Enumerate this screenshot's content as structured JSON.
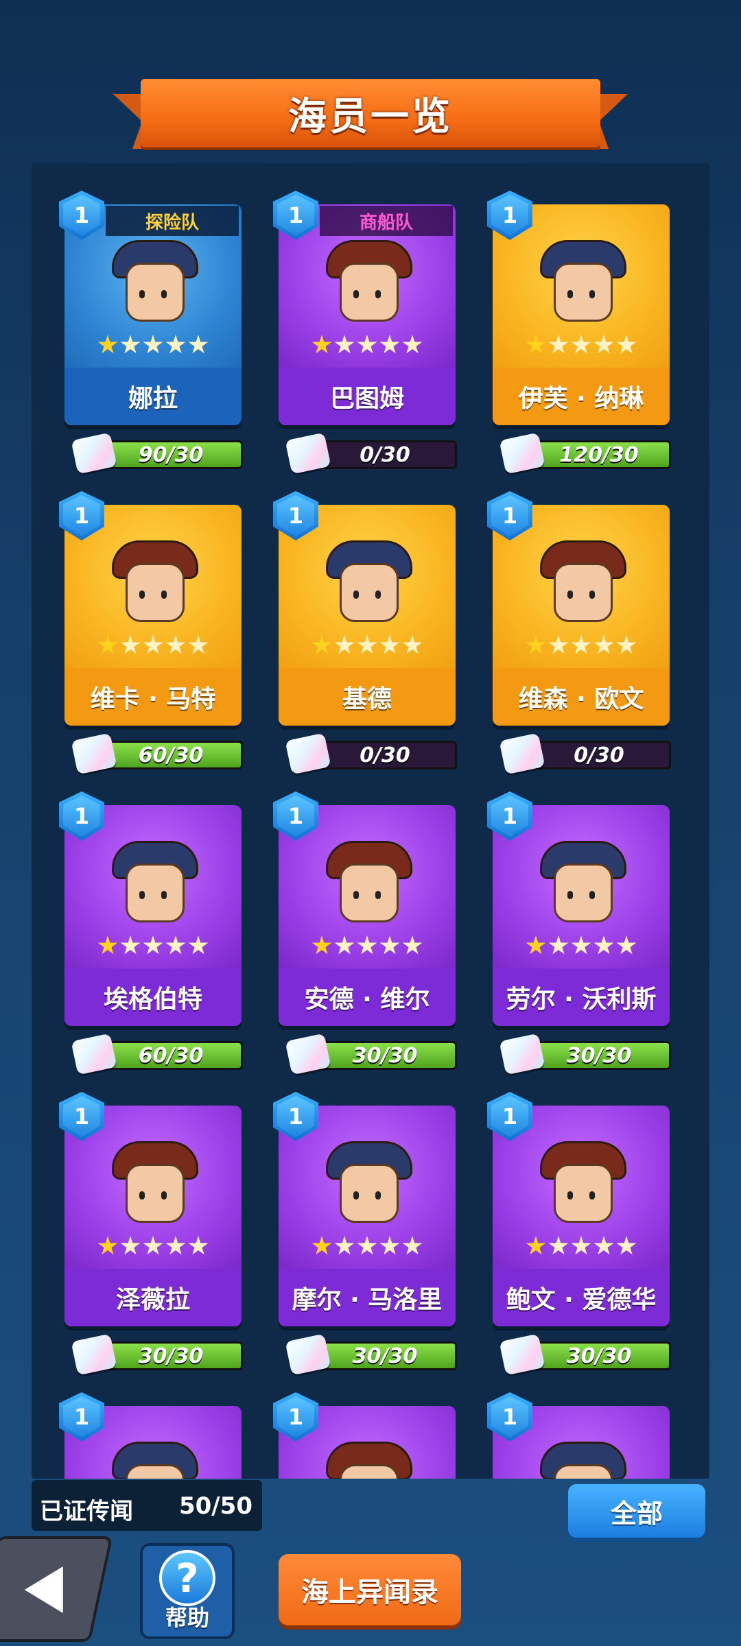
{
  "header": {
    "title": "海员一览"
  },
  "crew": [
    {
      "level": "1",
      "name": "娜拉",
      "team": "探险队",
      "rarity": "blue",
      "stars_filled": 1,
      "stars_total": 5,
      "shards": "90/30",
      "progress": 1.0,
      "accent": "#2f86d4"
    },
    {
      "level": "1",
      "name": "巴图姆",
      "team": "商船队",
      "rarity": "purple",
      "stars_filled": 1,
      "stars_total": 5,
      "shards": "0/30",
      "progress": 0.0,
      "accent": "#9b3fe8"
    },
    {
      "level": "1",
      "name": "伊芙 · 纳琳",
      "team": "",
      "rarity": "gold",
      "stars_filled": 1,
      "stars_total": 5,
      "shards": "120/30",
      "progress": 1.0,
      "accent": "#f9b520"
    },
    {
      "level": "1",
      "name": "维卡 · 马特",
      "team": "",
      "rarity": "gold",
      "stars_filled": 1,
      "stars_total": 5,
      "shards": "60/30",
      "progress": 1.0,
      "accent": "#f9b520"
    },
    {
      "level": "1",
      "name": "基德",
      "team": "",
      "rarity": "gold",
      "stars_filled": 1,
      "stars_total": 5,
      "shards": "0/30",
      "progress": 0.0,
      "accent": "#f9b520"
    },
    {
      "level": "1",
      "name": "维森 · 欧文",
      "team": "",
      "rarity": "gold",
      "stars_filled": 1,
      "stars_total": 5,
      "shards": "0/30",
      "progress": 0.0,
      "accent": "#f9b520"
    },
    {
      "level": "1",
      "name": "埃格伯特",
      "team": "",
      "rarity": "purple",
      "stars_filled": 1,
      "stars_total": 5,
      "shards": "60/30",
      "progress": 1.0,
      "accent": "#9b3fe8"
    },
    {
      "level": "1",
      "name": "安德 · 维尔",
      "team": "",
      "rarity": "purple",
      "stars_filled": 1,
      "stars_total": 5,
      "shards": "30/30",
      "progress": 1.0,
      "accent": "#9b3fe8"
    },
    {
      "level": "1",
      "name": "劳尔 · 沃利斯",
      "team": "",
      "rarity": "purple",
      "stars_filled": 1,
      "stars_total": 5,
      "shards": "30/30",
      "progress": 1.0,
      "accent": "#9b3fe8"
    },
    {
      "level": "1",
      "name": "泽薇拉",
      "team": "",
      "rarity": "purple",
      "stars_filled": 1,
      "stars_total": 5,
      "shards": "30/30",
      "progress": 1.0,
      "accent": "#9b3fe8"
    },
    {
      "level": "1",
      "name": "摩尔 · 马洛里",
      "team": "",
      "rarity": "purple",
      "stars_filled": 1,
      "stars_total": 5,
      "shards": "30/30",
      "progress": 1.0,
      "accent": "#9b3fe8"
    },
    {
      "level": "1",
      "name": "鲍文 · 爱德华",
      "team": "",
      "rarity": "purple",
      "stars_filled": 1,
      "stars_total": 5,
      "shards": "30/30",
      "progress": 1.0,
      "accent": "#9b3fe8"
    },
    {
      "level": "1",
      "name": "",
      "team": "",
      "rarity": "purple",
      "stars_filled": 0,
      "stars_total": 0,
      "shards": "",
      "progress": 0.0,
      "accent": "#9b3fe8"
    },
    {
      "level": "1",
      "name": "",
      "team": "",
      "rarity": "purple",
      "stars_filled": 0,
      "stars_total": 0,
      "shards": "",
      "progress": 0.0,
      "accent": "#9b3fe8"
    },
    {
      "level": "1",
      "name": "",
      "team": "",
      "rarity": "purple",
      "stars_filled": 0,
      "stars_total": 0,
      "shards": "",
      "progress": 0.0,
      "accent": "#9b3fe8"
    }
  ],
  "footer": {
    "collected_label": "已证传闻",
    "collected_value": "50/50",
    "filter_button": "全部",
    "back_icon": "back-arrow-icon",
    "help_icon": "question-mark-icon",
    "help_label": "帮助",
    "help_glyph": "?",
    "record_button": "海上异闻录"
  },
  "colors": {
    "blue": "#1c63bb",
    "purple": "#7d2bd6",
    "gold": "#f39a12",
    "title_orange": "#f56d14",
    "progress_green": "#6cc234"
  }
}
